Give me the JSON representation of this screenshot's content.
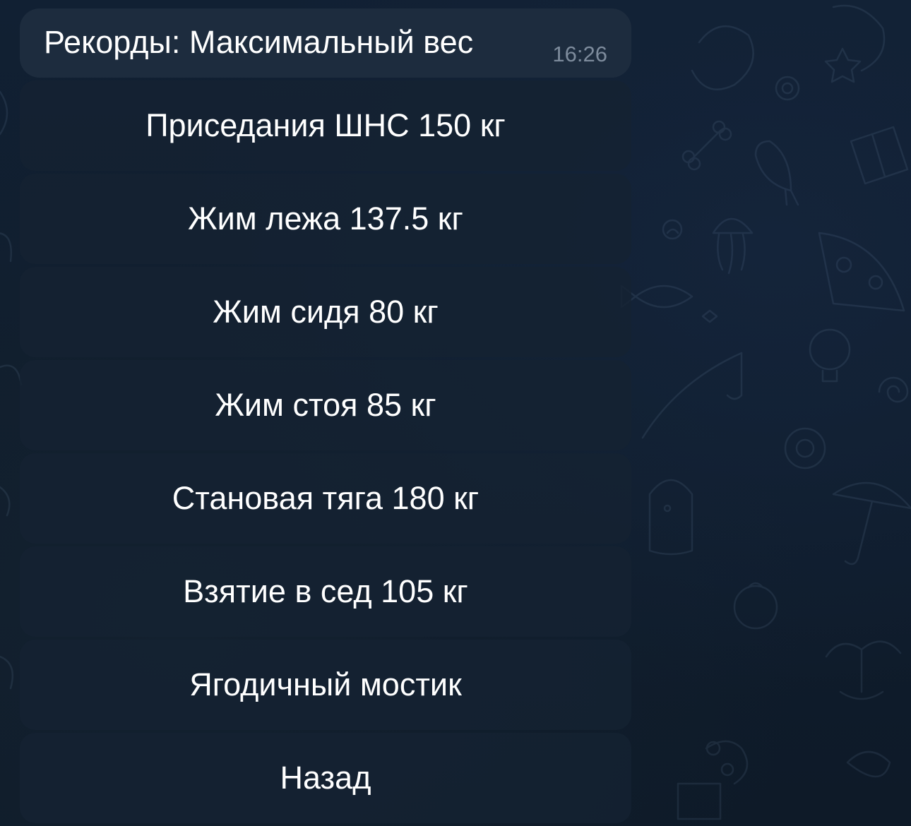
{
  "message": {
    "text": "Рекорды: Максимальный вес",
    "time": "16:26"
  },
  "keyboard": {
    "buttons": [
      {
        "label": "Приседания ШНС 150 кг"
      },
      {
        "label": "Жим лежа 137.5 кг"
      },
      {
        "label": "Жим сидя 80 кг"
      },
      {
        "label": "Жим стоя 85 кг"
      },
      {
        "label": "Становая тяга 180 кг"
      },
      {
        "label": "Взятие в сед 105 кг"
      },
      {
        "label": "Ягодичный мостик"
      },
      {
        "label": "Назад"
      }
    ]
  },
  "colors": {
    "background": "#0f1b29",
    "bubble": "#1d2c3e",
    "button": "#152232",
    "text": "#ffffff",
    "time": "#7d8b9c"
  }
}
